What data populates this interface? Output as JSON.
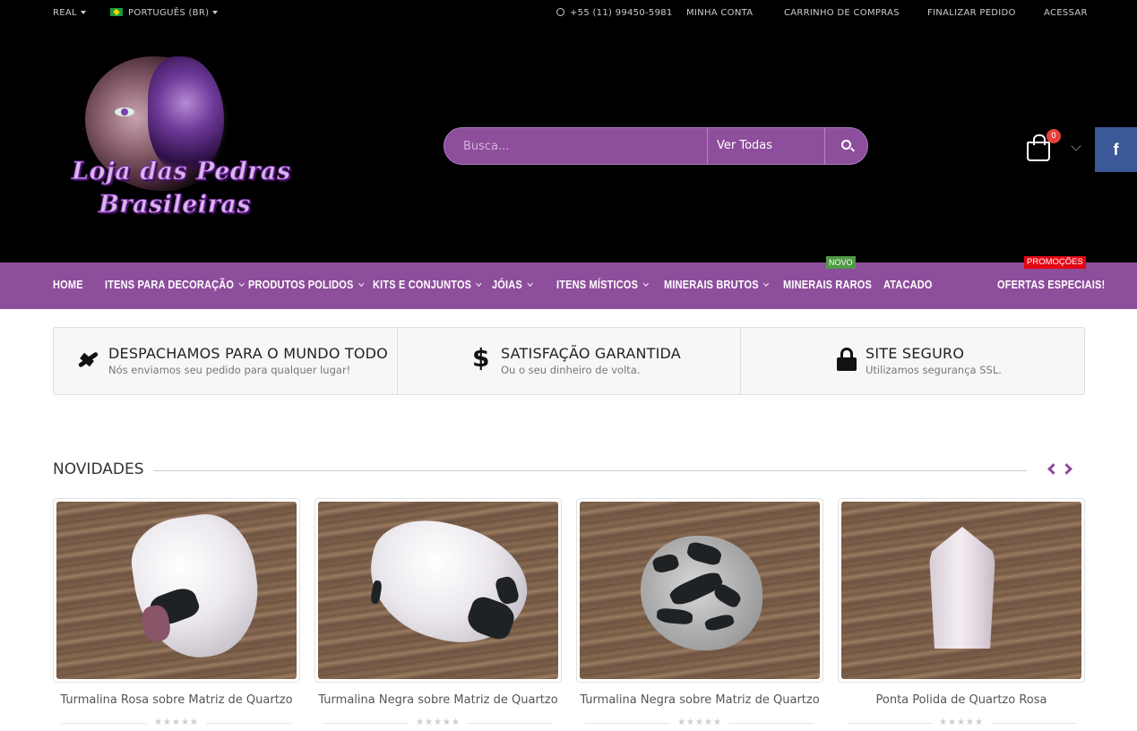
{
  "topbar": {
    "currency": "REAL",
    "language": "PORTUGUÊS (BR)",
    "phone": "+55 (11) 99450-5981",
    "links": [
      "MINHA CONTA",
      "CARRINHO DE COMPRAS",
      "FINALIZAR PEDIDO",
      "ACESSAR"
    ]
  },
  "logo": {
    "line1": "Loja das Pedras",
    "line2": "Brasileiras"
  },
  "search": {
    "placeholder": "Busca...",
    "category": "Ver Todas"
  },
  "cart": {
    "count": "0"
  },
  "social": {
    "facebook": "f"
  },
  "nav": {
    "items": [
      "HOME",
      "ITENS PARA DECORAÇÃO",
      "PRODUTOS POLIDOS",
      "KITS E CONJUNTOS",
      "JÓIAS",
      "ITENS MÍSTICOS",
      "MINERAIS BRUTOS",
      "MINERAIS RAROS",
      "ATACADO",
      "OFERTAS ESPECIAIS!"
    ],
    "tag_new": "NOVO",
    "tag_promo": "PROMOÇÕES"
  },
  "info": [
    {
      "icon": "airplane-icon",
      "title": "DESPACHAMOS PARA O MUNDO TODO",
      "subtitle": "Nós enviamos seu pedido para qualquer lugar!"
    },
    {
      "icon": "dollar-icon",
      "title": "SATISFAÇÃO GARANTIDA",
      "subtitle": "Ou o seu dinheiro de volta."
    },
    {
      "icon": "lock-icon",
      "title": "SITE SEGURO",
      "subtitle": "Utilizamos segurança SSL."
    }
  ],
  "section": {
    "title": "NOVIDADES"
  },
  "products": [
    {
      "name": "Turmalina Rosa sobre Matriz de Quartzo",
      "rating": "★★★★★"
    },
    {
      "name": "Turmalina Negra sobre Matriz de Quartzo",
      "rating": "★★★★★"
    },
    {
      "name": "Turmalina Negra sobre Matriz de Quartzo",
      "rating": "★★★★★"
    },
    {
      "name": "Ponta Polida de Quartzo Rosa",
      "rating": "★★★★★"
    }
  ],
  "colors": {
    "brand": "#8d4e9b",
    "header_bg": "#000000",
    "badge": "#e8413b",
    "new_tag": "#4f9a46",
    "promo_tag": "#e30613",
    "facebook": "#3b5998"
  }
}
